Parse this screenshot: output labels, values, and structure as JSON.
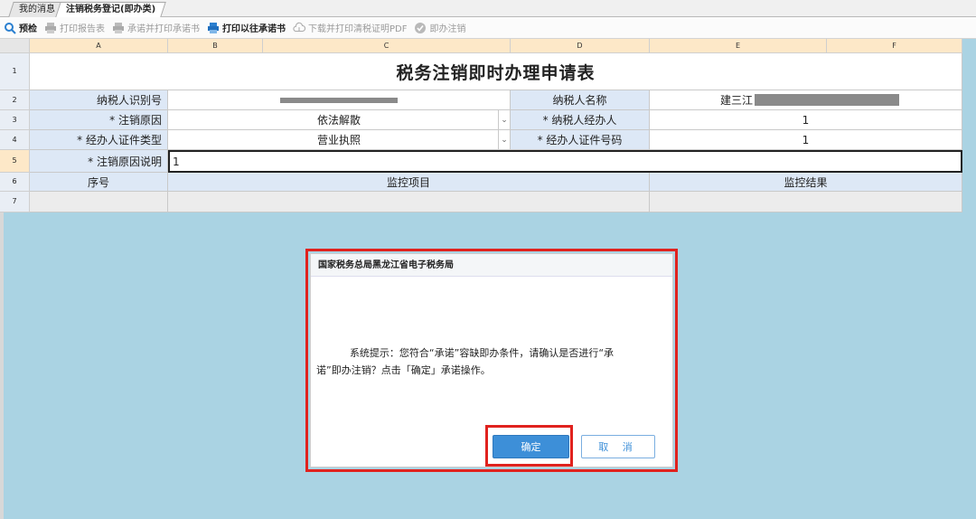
{
  "tabs": [
    {
      "label": "我的消息"
    },
    {
      "label": "注销税务登记(即办类)"
    }
  ],
  "toolbar": {
    "preview": "预检",
    "print_report": "打印报告表",
    "promise_print": "承诺并打印承诺书",
    "print_old_promise": "打印以往承诺书",
    "download_pdf": "下载并打印清税证明PDF",
    "instant_cancel": "即办注销"
  },
  "columns": [
    "A",
    "B",
    "C",
    "D",
    "E",
    "F"
  ],
  "rows": [
    "1",
    "2",
    "3",
    "4",
    "5",
    "6",
    "7"
  ],
  "form": {
    "title": "税务注销即时办理申请表",
    "taxpayer_id_label": "纳税人识别号",
    "taxpayer_name_label": "纳税人名称",
    "taxpayer_name_value": "建三江",
    "reason_label": "* 注销原因",
    "reason_value": "依法解散",
    "agent_label": "* 纳税人经办人",
    "agent_value": "1",
    "cert_type_label": "* 经办人证件类型",
    "cert_type_value": "营业执照",
    "cert_no_label": "* 经办人证件号码",
    "cert_no_value": "1",
    "reason_desc_label": "* 注销原因说明",
    "reason_desc_value": "1",
    "seq_header": "序号",
    "item_header": "监控项目",
    "result_header": "监控结果"
  },
  "dialog": {
    "title": "国家税务总局黑龙江省电子税务局",
    "message_line1": "系统提示：您符合“承诺”容缺即办条件，请确认是否进行“承",
    "message_line2": "诺”即办注销？点击「确定」承诺操作。",
    "ok_label": "确定",
    "cancel_label": "取 消"
  },
  "colors": {
    "accent": "#3d8fd8",
    "highlight": "#e0221e",
    "background": "#aad3e3"
  }
}
